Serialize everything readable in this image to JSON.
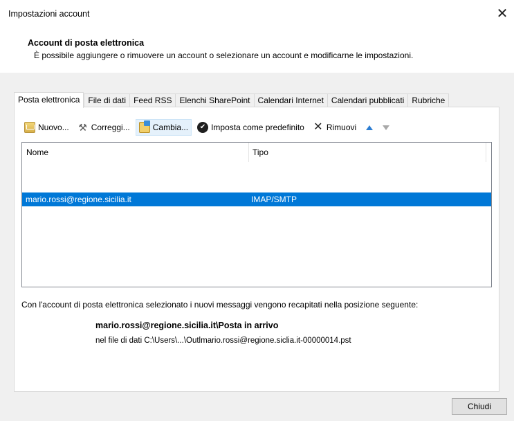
{
  "window": {
    "title": "Impostazioni account",
    "close_glyph": "✕"
  },
  "header": {
    "title": "Account di posta elettronica",
    "description": "È possibile aggiungere o rimuovere un account o selezionare un account e modificarne le impostazioni."
  },
  "tabs": [
    {
      "label": "Posta elettronica",
      "active": true
    },
    {
      "label": "File di dati",
      "active": false
    },
    {
      "label": "Feed RSS",
      "active": false
    },
    {
      "label": "Elenchi SharePoint",
      "active": false
    },
    {
      "label": "Calendari Internet",
      "active": false
    },
    {
      "label": "Calendari pubblicati",
      "active": false
    },
    {
      "label": "Rubriche",
      "active": false
    }
  ],
  "toolbar": {
    "new_label": "Nuovo...",
    "repair_label": "Correggi...",
    "change_label": "Cambia...",
    "default_label": "Imposta come predefinito",
    "remove_label": "Rimuovi",
    "icons": [
      "new-account-icon",
      "repair-tools-icon",
      "change-account-icon",
      "check-circle-icon",
      "remove-x-icon",
      "arrow-up-icon",
      "arrow-down-icon"
    ]
  },
  "list": {
    "columns": [
      "Nome",
      "Tipo"
    ],
    "rows": [
      {
        "name": "mario.rossi@regione.sicilia.it",
        "type": "IMAP/SMTP",
        "selected": true
      }
    ]
  },
  "delivery": {
    "info": "Con l'account di posta elettronica selezionato i nuovi messaggi vengono recapitati nella posizione seguente:",
    "folder": "mario.rossi@regione.sicilia.it\\Posta in arrivo",
    "data_file": "nel file di dati C:\\Users\\...\\Outlmario.rossi@regione.siclia.it-00000014.pst"
  },
  "footer": {
    "close_label": "Chiudi"
  },
  "colors": {
    "selection": "#0078d7",
    "dialog_bg": "#f0f0f0"
  }
}
